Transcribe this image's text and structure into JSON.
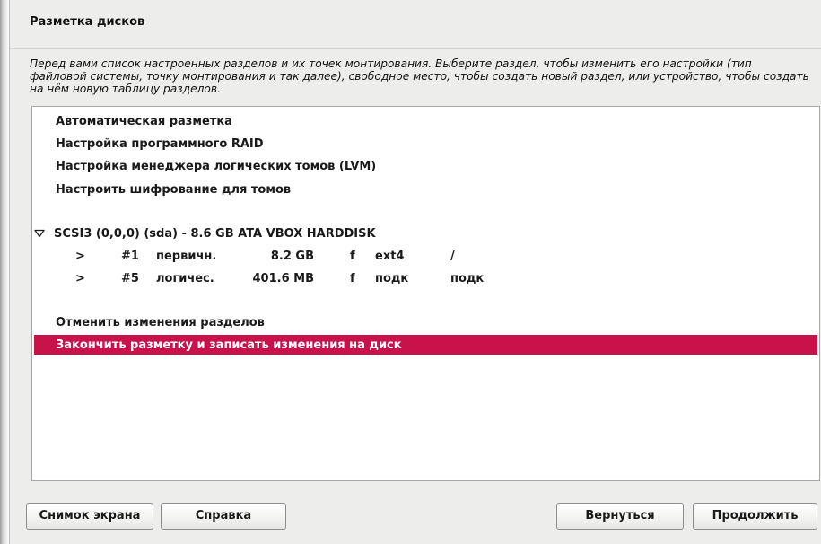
{
  "window": {
    "title": "Разметка дисков"
  },
  "description": "Перед вами список настроенных разделов и их точек монтирования. Выберите раздел, чтобы изменить его настройки (тип файловой системы, точку монтирования и так далее), свободное место, чтобы создать новый раздел, или устройство, чтобы создать на нём новую таблицу разделов.",
  "menu_items": [
    {
      "label": "Автоматическая разметка"
    },
    {
      "label": "Настройка программного RAID"
    },
    {
      "label": "Настройка менеджера логических томов (LVM)"
    },
    {
      "label": "Настроить шифрование для томов"
    }
  ],
  "disk": {
    "label": "SCSI3 (0,0,0) (sda) - 8.6 GB ATA VBOX HARDDISK",
    "expander_icon": "triangle-down-icon",
    "partitions": [
      {
        "marker": ">",
        "number": "#1",
        "type": "первичн.",
        "size": "8.2 GB",
        "flag": "f",
        "fs": "ext4",
        "mount": "/"
      },
      {
        "marker": ">",
        "number": "#5",
        "type": "логичес.",
        "size": "401.6 MB",
        "flag": "f",
        "fs": "подк",
        "mount": "подк"
      }
    ]
  },
  "actions": [
    {
      "label": "Отменить изменения разделов",
      "selected": false
    },
    {
      "label": "Закончить разметку и записать изменения на диск",
      "selected": true
    }
  ],
  "buttons": {
    "screenshot": "Снимок экрана",
    "help": "Справка",
    "back": "Вернуться",
    "continue": "Продолжить"
  },
  "colors": {
    "selection": "#c9114a",
    "window_bg": "#ededec",
    "list_bg": "#ffffff"
  }
}
